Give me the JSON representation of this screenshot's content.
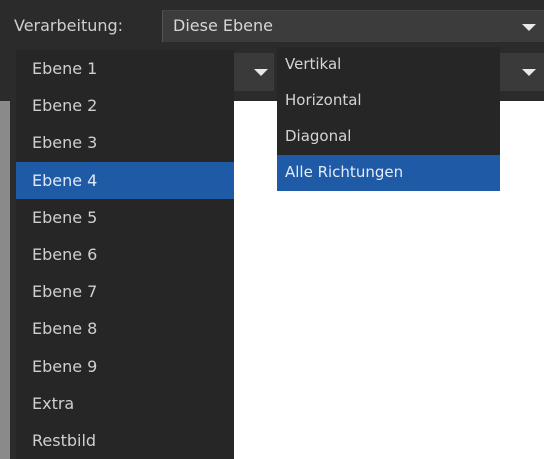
{
  "processing": {
    "label": "Verarbeitung:",
    "value": "Diese Ebene"
  },
  "layers": {
    "items": [
      {
        "label": "Ebene 1"
      },
      {
        "label": "Ebene 2"
      },
      {
        "label": "Ebene 3"
      },
      {
        "label": "Ebene 4",
        "selected": true
      },
      {
        "label": "Ebene 5"
      },
      {
        "label": "Ebene 6"
      },
      {
        "label": "Ebene 7"
      },
      {
        "label": "Ebene 8"
      },
      {
        "label": "Ebene 9"
      },
      {
        "label": "Extra"
      },
      {
        "label": "Restbild"
      }
    ]
  },
  "directions": {
    "items": [
      {
        "label": "Vertikal"
      },
      {
        "label": "Horizontal"
      },
      {
        "label": "Diagonal"
      },
      {
        "label": "Alle Richtungen",
        "selected": true
      }
    ]
  },
  "colors": {
    "panel": "#2b2b2b",
    "list_bg": "#262626",
    "selection": "#1e5aa6",
    "text": "#cfcfcf"
  },
  "icons": {
    "dropdown": "chevron-down-icon"
  }
}
